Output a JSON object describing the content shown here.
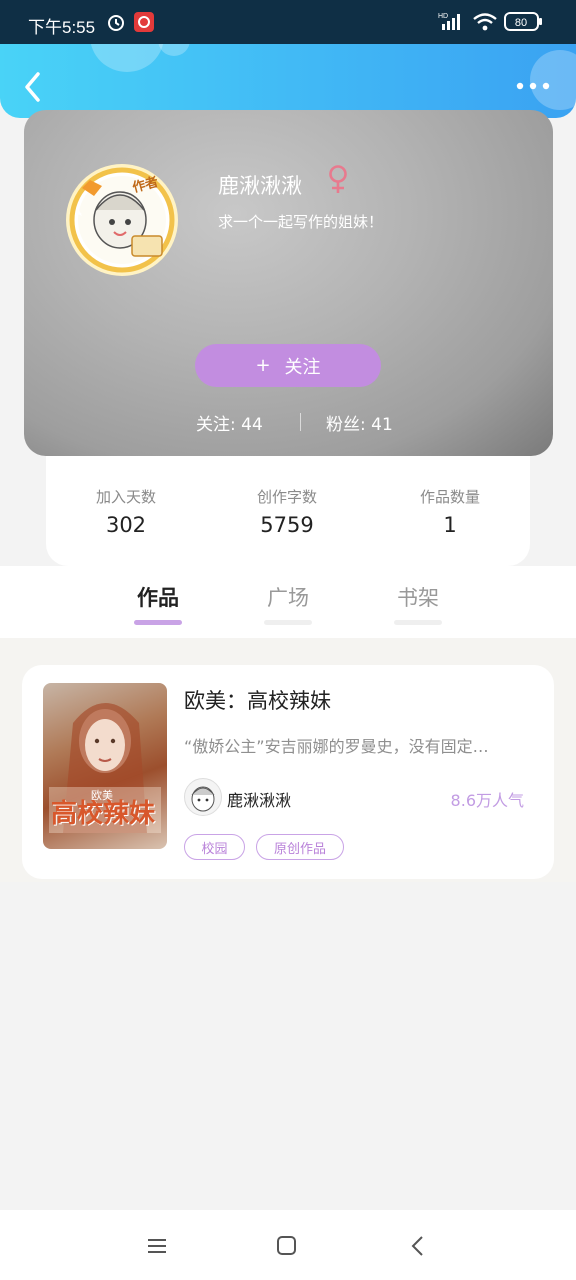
{
  "status_bar": {
    "time": "下午5:55",
    "battery": "80",
    "hd_label": "HD"
  },
  "header": {
    "back_icon": "chevron-left-icon",
    "more_icon": "more-horizontal-icon"
  },
  "profile": {
    "name": "鹿湫湫湫",
    "gender_icon": "female-icon",
    "bio": "求一个一起写作的姐妹！",
    "avatar_badge": "作者",
    "follow_button": {
      "plus": "+",
      "label": "关注"
    },
    "following": "关注: 44",
    "fans": "粉丝: 41"
  },
  "stats": [
    {
      "label": "加入天数",
      "value": "302"
    },
    {
      "label": "创作字数",
      "value": "5759"
    },
    {
      "label": "作品数量",
      "value": "1"
    }
  ],
  "tabs": [
    {
      "label": "作品",
      "active": true
    },
    {
      "label": "广场",
      "active": false
    },
    {
      "label": "书架",
      "active": false
    }
  ],
  "works": [
    {
      "title": "欧美：高校辣妹",
      "description": "“傲娇公主”安吉丽娜的罗曼史，没有固定…",
      "author": "鹿湫湫湫",
      "popularity": "8.6万人气",
      "tags": [
        "校园",
        "原创作品"
      ],
      "cover_text": "高校辣妹",
      "cover_subtext": "欧美"
    }
  ],
  "navbar": {
    "menu_icon": "menu-icon",
    "home_icon": "home-square-icon",
    "back_icon": "back-triangle-icon"
  },
  "colors": {
    "accent": "#c28de0",
    "header_gradient_start": "#49d3f7",
    "header_gradient_end": "#3aa2f2"
  }
}
